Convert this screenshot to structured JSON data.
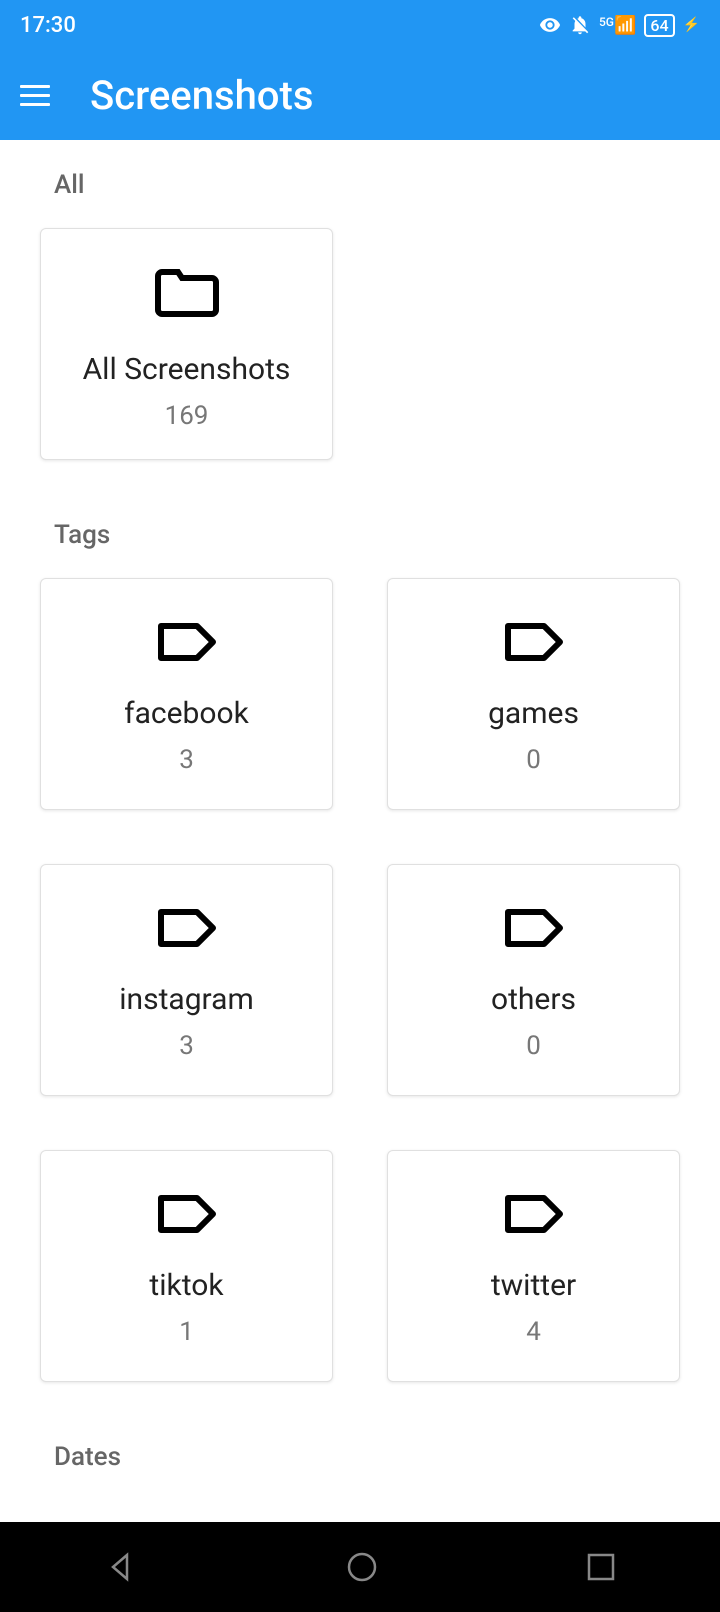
{
  "status_bar": {
    "time": "17:30",
    "network_label": "5G",
    "battery": "64"
  },
  "header": {
    "title": "Screenshots"
  },
  "sections": {
    "all_label": "All",
    "tags_label": "Tags",
    "dates_label": "Dates"
  },
  "all_card": {
    "title": "All Screenshots",
    "count": "169"
  },
  "tags": [
    {
      "name": "facebook",
      "count": "3"
    },
    {
      "name": "games",
      "count": "0"
    },
    {
      "name": "instagram",
      "count": "3"
    },
    {
      "name": "others",
      "count": "0"
    },
    {
      "name": "tiktok",
      "count": "1"
    },
    {
      "name": "twitter",
      "count": "4"
    }
  ]
}
